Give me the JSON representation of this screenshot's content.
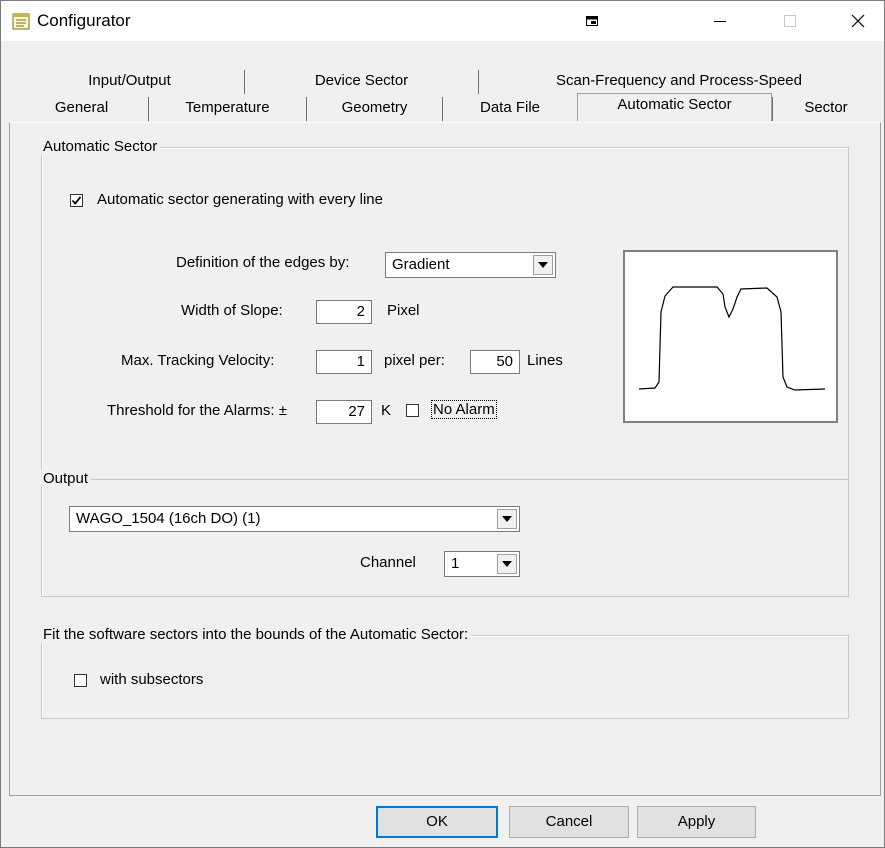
{
  "window": {
    "title": "Configurator"
  },
  "tabs_row1": [
    "Input/Output",
    "Device Sector",
    "Scan-Frequency and Process-Speed"
  ],
  "tabs_row2": [
    "General",
    "Temperature",
    "Geometry",
    "Data File",
    "Automatic Sector",
    "Sector"
  ],
  "auto_sector": {
    "group_label": "Automatic Sector",
    "generate_checkbox": {
      "label": "Automatic sector generating with every line",
      "checked": true
    },
    "edges_label": "Definition of the edges by:",
    "edges_value": "Gradient",
    "slope_label": "Width of Slope:",
    "slope_value": "2",
    "slope_unit": "Pixel",
    "velocity_label": "Max. Tracking Velocity:",
    "velocity_value": "1",
    "velocity_mid": "pixel per:",
    "velocity_lines_value": "50",
    "velocity_unit": "Lines",
    "threshold_label": "Threshold for the Alarms: ±",
    "threshold_value": "27",
    "threshold_unit": "K",
    "no_alarm_label": "No Alarm",
    "no_alarm_checked": false
  },
  "output": {
    "group_label": "Output",
    "device_value": "WAGO_1504 (16ch DO) (1)",
    "channel_label": "Channel",
    "channel_value": "1"
  },
  "fit": {
    "group_label": "Fit the software sectors into the bounds of the Automatic Sector:",
    "subsectors_label": "with subsectors",
    "subsectors_checked": false
  },
  "buttons": {
    "ok": "OK",
    "cancel": "Cancel",
    "apply": "Apply"
  },
  "icons": {
    "app": "notepad-icon",
    "restore": "restore-icon",
    "minimize": "minimize-icon",
    "maximize": "maximize-icon",
    "close": "close-icon"
  }
}
